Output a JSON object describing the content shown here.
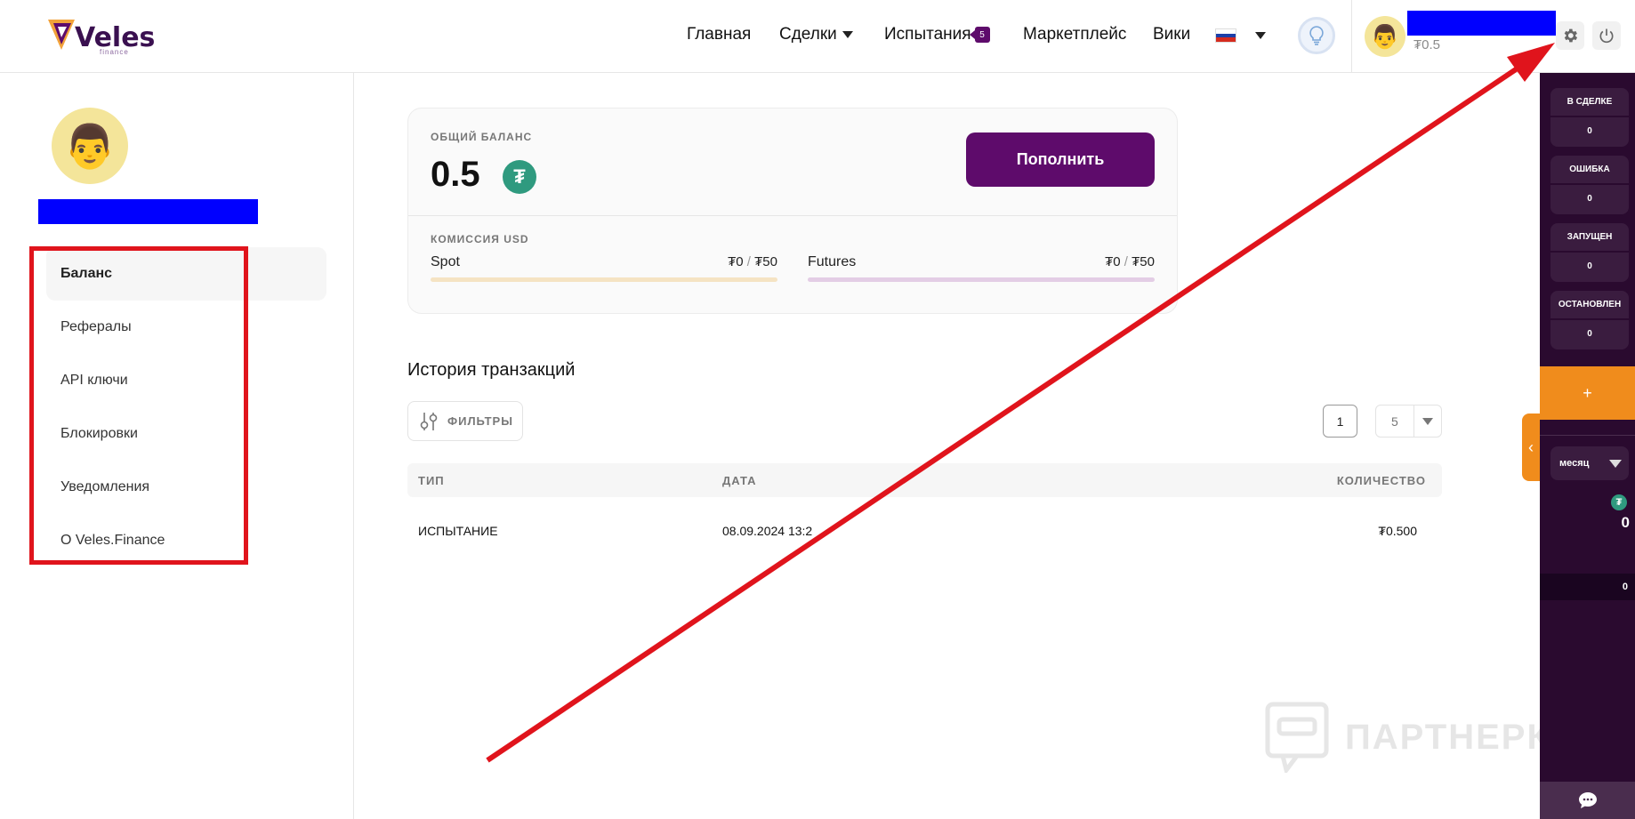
{
  "header": {
    "logo_text": "Veles",
    "logo_sub": "finance",
    "nav": [
      {
        "label": "Главная"
      },
      {
        "label": "Сделки"
      },
      {
        "label": "Испытания",
        "badge": "5"
      },
      {
        "label": "Маркетплейс"
      },
      {
        "label": "Вики"
      }
    ],
    "balance": "₮0.5"
  },
  "sidebar": {
    "items": [
      {
        "label": "Баланс"
      },
      {
        "label": "Рефералы"
      },
      {
        "label": "API ключи"
      },
      {
        "label": "Блокировки"
      },
      {
        "label": "Уведомления"
      },
      {
        "label": "О Veles.Finance"
      }
    ]
  },
  "balance_card": {
    "label": "ОБЩИЙ БАЛАНС",
    "value": "0.5",
    "topup_label": "Пополнить",
    "commission_label": "КОМИССИЯ USD",
    "spot": {
      "label": "Spot",
      "used": "₮0",
      "limit": "₮50",
      "bar_color": "#f5e3c3"
    },
    "futures": {
      "label": "Futures",
      "used": "₮0",
      "limit": "₮50",
      "bar_color": "#e3cde5"
    }
  },
  "history": {
    "title": "История транзакций",
    "filters_label": "ФИЛЬТРЫ",
    "page": "1",
    "per_page": "5",
    "columns": [
      "ТИП",
      "ДАТА",
      "КОЛИЧЕСТВО"
    ],
    "rows": [
      {
        "type": "ИСПЫТАНИЕ",
        "date": "08.09.2024 13:2",
        "amount": "₮0.500"
      }
    ]
  },
  "right_panel": {
    "stats": [
      {
        "label": "В СДЕЛКЕ",
        "value": "0"
      },
      {
        "label": "ОШИБКА",
        "value": "0"
      },
      {
        "label": "ЗАПУЩЕН",
        "value": "0"
      },
      {
        "label": "ОСТАНОВЛЕН",
        "value": "0"
      }
    ],
    "add_label": "+",
    "period": "месяц",
    "total": "0",
    "strip_value": "0"
  },
  "watermark": "ПАРТНЕРКИН",
  "colors": {
    "brand": "#5e0b6b",
    "accent": "#f08c1c",
    "annotation": "#e0141c",
    "tether": "#2f9a7f"
  }
}
